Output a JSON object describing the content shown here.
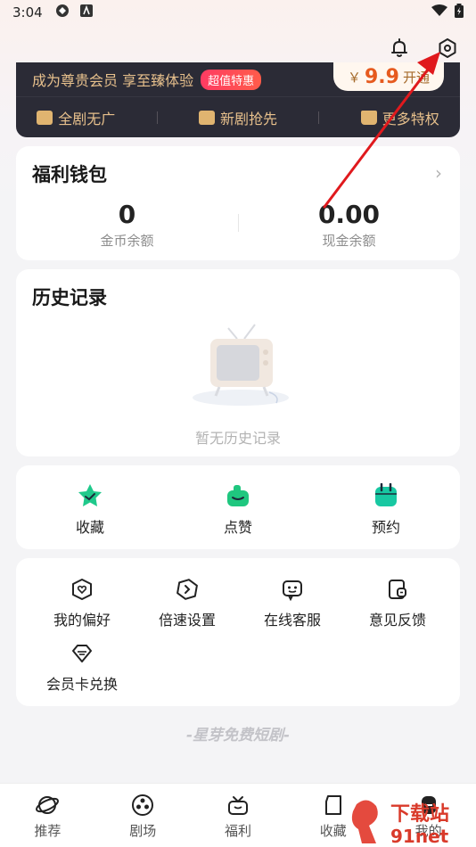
{
  "status_bar": {
    "time": "3:04"
  },
  "vip": {
    "promo_text": "成为尊贵会员 享至臻体验",
    "tag": "超值特惠",
    "currency": "￥",
    "price": "9.9",
    "open_label": "开通",
    "perks": [
      {
        "label": "全剧无广",
        "icon": "ad-free-icon"
      },
      {
        "label": "新剧抢先",
        "icon": "new-drama-icon"
      },
      {
        "label": "更多特权",
        "icon": "crown-icon"
      }
    ]
  },
  "wallet": {
    "title": "福利钱包",
    "coins_value": "0",
    "coins_label": "金币余额",
    "cash_value": "0.00",
    "cash_label": "现金余额"
  },
  "history": {
    "title": "历史记录",
    "empty_text": "暂无历史记录"
  },
  "shortcuts": [
    {
      "label": "收藏",
      "icon": "star-icon",
      "color": "#19c98a"
    },
    {
      "label": "点赞",
      "icon": "thumb-up-icon",
      "color": "#1fc77f"
    },
    {
      "label": "预约",
      "icon": "calendar-icon",
      "color": "#16c8a3"
    }
  ],
  "tools": [
    {
      "label": "我的偏好",
      "icon": "heart-shield-icon"
    },
    {
      "label": "倍速设置",
      "icon": "speed-icon"
    },
    {
      "label": "在线客服",
      "icon": "chat-bot-icon"
    },
    {
      "label": "意见反馈",
      "icon": "feedback-icon"
    },
    {
      "label": "会员卡兑换",
      "icon": "diamond-card-icon"
    }
  ],
  "slogan": "-星芽免费短剧-",
  "bottom_nav": [
    {
      "label": "推荐",
      "icon": "planet-icon"
    },
    {
      "label": "剧场",
      "icon": "film-reel-icon"
    },
    {
      "label": "福利",
      "icon": "gift-icon"
    },
    {
      "label": "收藏",
      "icon": "bookmark-icon"
    },
    {
      "label": "我的",
      "icon": "user-icon"
    }
  ],
  "watermark": {
    "text": "下载站",
    "domain": "91net"
  }
}
